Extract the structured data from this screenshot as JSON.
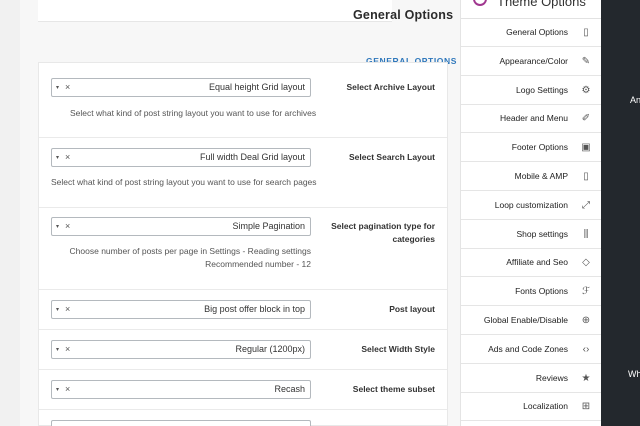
{
  "header": {
    "title": "General Options"
  },
  "section": {
    "title": "GENERAL OPTIONS"
  },
  "rows": [
    {
      "label": "Select Archive Layout",
      "value": "Equal height Grid layout",
      "desc": "Select what kind of post string layout you want to use for archives"
    },
    {
      "label": "Select Search Layout",
      "value": "Full width Deal Grid layout",
      "desc": "Select what kind of post string layout you want to use for search pages"
    },
    {
      "label_line1": "Select pagination type for",
      "label_line2": "categories",
      "value": "Simple Pagination",
      "desc_line1": "Choose number of posts per page in Settings - Reading settings",
      "desc_line2": "Recommended number - 12"
    },
    {
      "label": "Post layout",
      "value": "Big post offer block in top"
    },
    {
      "label": "Select Width Style",
      "value": "Regular (1200px)"
    },
    {
      "label": "Select theme subset",
      "value": "Recash"
    }
  ],
  "select_controls": {
    "arrow": "▾",
    "clear": "×"
  },
  "sidebar": {
    "title": "Theme Options",
    "items": [
      {
        "label": "General Options",
        "icon": "tablet-icon",
        "glyph": "▯"
      },
      {
        "label": "Appearance/Color",
        "icon": "edit-icon",
        "glyph": "✎"
      },
      {
        "label": "Logo Settings",
        "icon": "gear-icon",
        "glyph": "⚙"
      },
      {
        "label": "Header and Menu",
        "icon": "pencil-icon",
        "glyph": "✐"
      },
      {
        "label": "Footer Options",
        "icon": "footer-icon",
        "glyph": "▣"
      },
      {
        "label": "Mobile & AMP",
        "icon": "smartphone-icon",
        "glyph": "▯"
      },
      {
        "label": "Loop customization",
        "icon": "resize-icon",
        "glyph": "⤢"
      },
      {
        "label": "Shop settings",
        "icon": "sliders-icon",
        "glyph": "⫼"
      },
      {
        "label": "Affiliate and Seo",
        "icon": "tag-icon",
        "glyph": "◇"
      },
      {
        "label": "Fonts Options",
        "icon": "font-icon",
        "glyph": "ℱ"
      },
      {
        "label": "Global Enable/Disable",
        "icon": "globe-icon",
        "glyph": "⊕"
      },
      {
        "label": "Ads and Code Zones",
        "icon": "code-icon",
        "glyph": "‹›"
      },
      {
        "label": "Reviews",
        "icon": "star-icon",
        "glyph": "★"
      },
      {
        "label": "Localization",
        "icon": "translation-icon",
        "glyph": "⊞"
      }
    ]
  },
  "edge": {
    "text1": "An",
    "text2": "Wh"
  },
  "colors": {
    "accent": "#2e77bb",
    "dark": "#23282d",
    "logo": "#a0378f"
  }
}
